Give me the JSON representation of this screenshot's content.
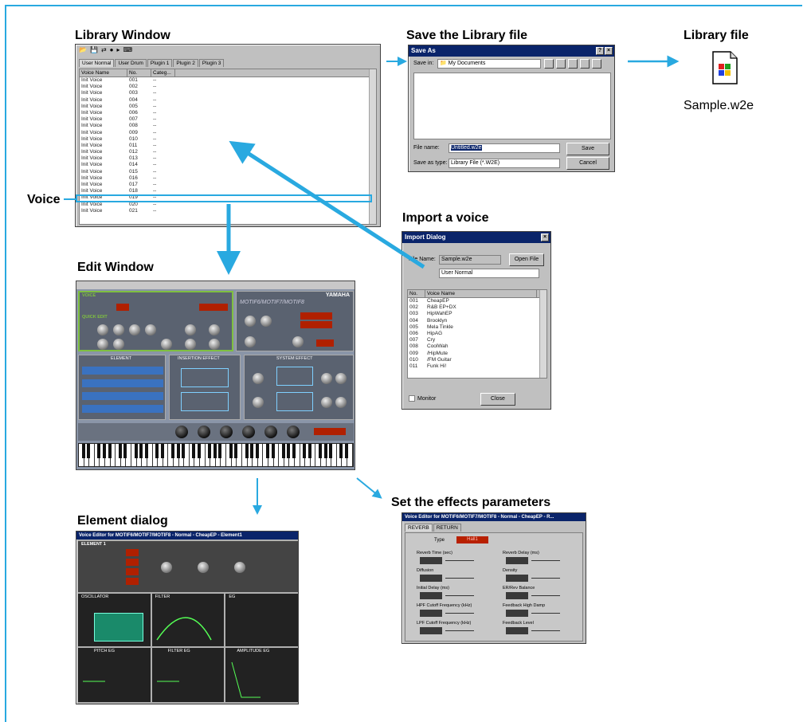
{
  "captions": {
    "library_window": "Library Window",
    "save_file": "Save the Library file",
    "library_file": "Library file",
    "voice": "Voice",
    "import_voice": "Import a voice",
    "edit_window": "Edit Window",
    "element_dialog": "Element dialog",
    "set_effects": "Set the effects parameters"
  },
  "colors": {
    "arrow": "#29a9e0",
    "titlebar": "#0a246a",
    "frame": "#29a9e0"
  },
  "library": {
    "tabs": [
      "User Normal",
      "User Drum",
      "Plugin 1",
      "Plugin 2",
      "Plugin 3"
    ],
    "columns": [
      "Voice Name",
      "No.",
      "Categ..."
    ],
    "rows": [
      {
        "name": "Init Voice",
        "no": "001",
        "cat": "--"
      },
      {
        "name": "Init Voice",
        "no": "002",
        "cat": "--"
      },
      {
        "name": "Init Voice",
        "no": "003",
        "cat": "--"
      },
      {
        "name": "Init Voice",
        "no": "004",
        "cat": "--"
      },
      {
        "name": "Init Voice",
        "no": "005",
        "cat": "--"
      },
      {
        "name": "Init Voice",
        "no": "006",
        "cat": "--"
      },
      {
        "name": "Init Voice",
        "no": "007",
        "cat": "--"
      },
      {
        "name": "Init Voice",
        "no": "008",
        "cat": "--"
      },
      {
        "name": "Init Voice",
        "no": "009",
        "cat": "--"
      },
      {
        "name": "Init Voice",
        "no": "010",
        "cat": "--"
      },
      {
        "name": "Init Voice",
        "no": "011",
        "cat": "--"
      },
      {
        "name": "Init Voice",
        "no": "012",
        "cat": "--"
      },
      {
        "name": "Init Voice",
        "no": "013",
        "cat": "--"
      },
      {
        "name": "Init Voice",
        "no": "014",
        "cat": "--"
      },
      {
        "name": "Init Voice",
        "no": "015",
        "cat": "--"
      },
      {
        "name": "Init Voice",
        "no": "016",
        "cat": "--"
      },
      {
        "name": "Init Voice",
        "no": "017",
        "cat": "--"
      },
      {
        "name": "Init Voice",
        "no": "018",
        "cat": "--"
      },
      {
        "name": "Init Voice",
        "no": "019",
        "cat": "--"
      },
      {
        "name": "Init Voice",
        "no": "020",
        "cat": "--"
      },
      {
        "name": "Init Voice",
        "no": "021",
        "cat": "--"
      }
    ]
  },
  "save_as": {
    "title": "Save As",
    "save_in_label": "Save in:",
    "save_in_value": "My Documents",
    "file_name_label": "File name:",
    "file_name_value": "Untitled.w2e",
    "save_type_label": "Save as type:",
    "save_type_value": "Library File (*.W2E)",
    "save_button": "Save",
    "cancel_button": "Cancel"
  },
  "library_file": {
    "name": "Sample.w2e",
    "icon": "document-icon"
  },
  "import_dialog": {
    "title": "Import Dialog",
    "file_name_label": "File Name:",
    "file_name_value": "Sample.w2e",
    "open_button": "Open File",
    "bank_value": "User Normal",
    "columns": [
      "No.",
      "Voice Name"
    ],
    "rows": [
      {
        "no": "001",
        "name": "CheapEP"
      },
      {
        "no": "002",
        "name": "R&B EP+DX"
      },
      {
        "no": "003",
        "name": "HipWahEP"
      },
      {
        "no": "004",
        "name": "Brooklyn"
      },
      {
        "no": "005",
        "name": "Mela Tinkle"
      },
      {
        "no": "006",
        "name": "HipAG"
      },
      {
        "no": "007",
        "name": "Cry"
      },
      {
        "no": "008",
        "name": "CoolWah"
      },
      {
        "no": "009",
        "name": "/HipMute"
      },
      {
        "no": "010",
        "name": "/FM Guitar"
      },
      {
        "no": "011",
        "name": "Funk Hi!"
      }
    ],
    "monitor_label": "Monitor",
    "close_button": "Close"
  },
  "edit_window": {
    "brand": "YAMAHA",
    "model": "MOTIF6/MOTIF7/MOTIF8",
    "voice_label": "VOICE",
    "quick_edit_label": "QUICK EDIT",
    "element_label": "ELEMENT",
    "insertion_label": "INSERTION EFFECT",
    "system_label": "SYSTEM EFFECT"
  },
  "element_dialog": {
    "title": "Voice Editor for MOTIF6/MOTIF7/MOTIF8 - Normal - CheapEP - Element1",
    "element_label": "ELEMENT 1",
    "sections": [
      "OSCILLATOR",
      "FILTER",
      "EG",
      "PITCH EG",
      "FILTER EG",
      "AMPLITUDE EG"
    ]
  },
  "effects_dialog": {
    "title": "Voice Editor for MOTIF6/MOTIF7/MOTIF8 - Normal - CheapEP - R...",
    "tabs": [
      "REVERB",
      "RETURN"
    ],
    "type_label": "Type",
    "type_value": "Hall1",
    "params_left": [
      "Reverb Time (sec)",
      "Diffusion",
      "Initial Delay (ms)",
      "HPF Cutoff Frequency (kHz)",
      "LPF Cutoff Frequency (kHz)"
    ],
    "params_right": [
      "Reverb Delay (ms)",
      "Density",
      "ER/Rev Balance",
      "Feedback High Damp",
      "Feedback Level"
    ]
  }
}
